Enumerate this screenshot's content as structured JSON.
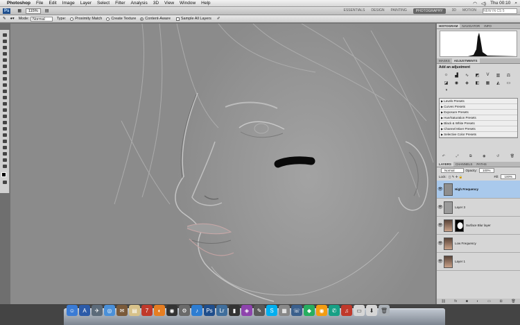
{
  "menubar": {
    "app": "Photoshop",
    "items": [
      "File",
      "Edit",
      "Image",
      "Layer",
      "Select",
      "Filter",
      "Analysis",
      "3D",
      "View",
      "Window",
      "Help"
    ],
    "clock": "Thu 00:10"
  },
  "appbar": {
    "logo": "Ps",
    "zoom": "115%",
    "workspaces": [
      "ESSENTIALS",
      "DESIGN",
      "PAINTING",
      "PHOTOGRAPHY",
      "3D",
      "MOTION"
    ],
    "active_workspace": "PHOTOGRAPHY",
    "search_placeholder": "NEW IN CS 5"
  },
  "options": {
    "mode_label": "Mode:",
    "mode_value": "Normal",
    "type_label": "Type:",
    "type_options": [
      "Proximity Match",
      "Create Texture",
      "Content-Aware"
    ],
    "sample_label": "Sample All Layers"
  },
  "panels": {
    "top_tabs": [
      "HISTOGRAM",
      "NAVIGATOR",
      "INFO"
    ],
    "mid_tabs": [
      "MASKS",
      "ADJUSTMENTS"
    ],
    "adj_title": "Add an adjustment",
    "presets": [
      "Levels Presets",
      "Curves Presets",
      "Exposure Presets",
      "Hue/Saturation Presets",
      "Black & White Presets",
      "Channel Mixer Presets",
      "Selective Color Presets"
    ],
    "layer_tabs": [
      "LAYERS",
      "CHANNELS",
      "PATHS"
    ],
    "blend_mode": "Normal",
    "opacity_label": "Opacity:",
    "opacity": "100%",
    "lock_label": "Lock:",
    "fill_label": "Fill:",
    "fill": "100%",
    "layers": [
      {
        "name": "High Frequency",
        "selected": true
      },
      {
        "name": "Layer 3",
        "selected": false
      },
      {
        "name": "Surface Blur layer",
        "selected": false
      },
      {
        "name": "Low Frequency",
        "selected": false
      },
      {
        "name": "Layer 1",
        "selected": false
      }
    ]
  },
  "colors": {
    "selected_layer": "#a9c9ec",
    "canvas": "#959595"
  }
}
